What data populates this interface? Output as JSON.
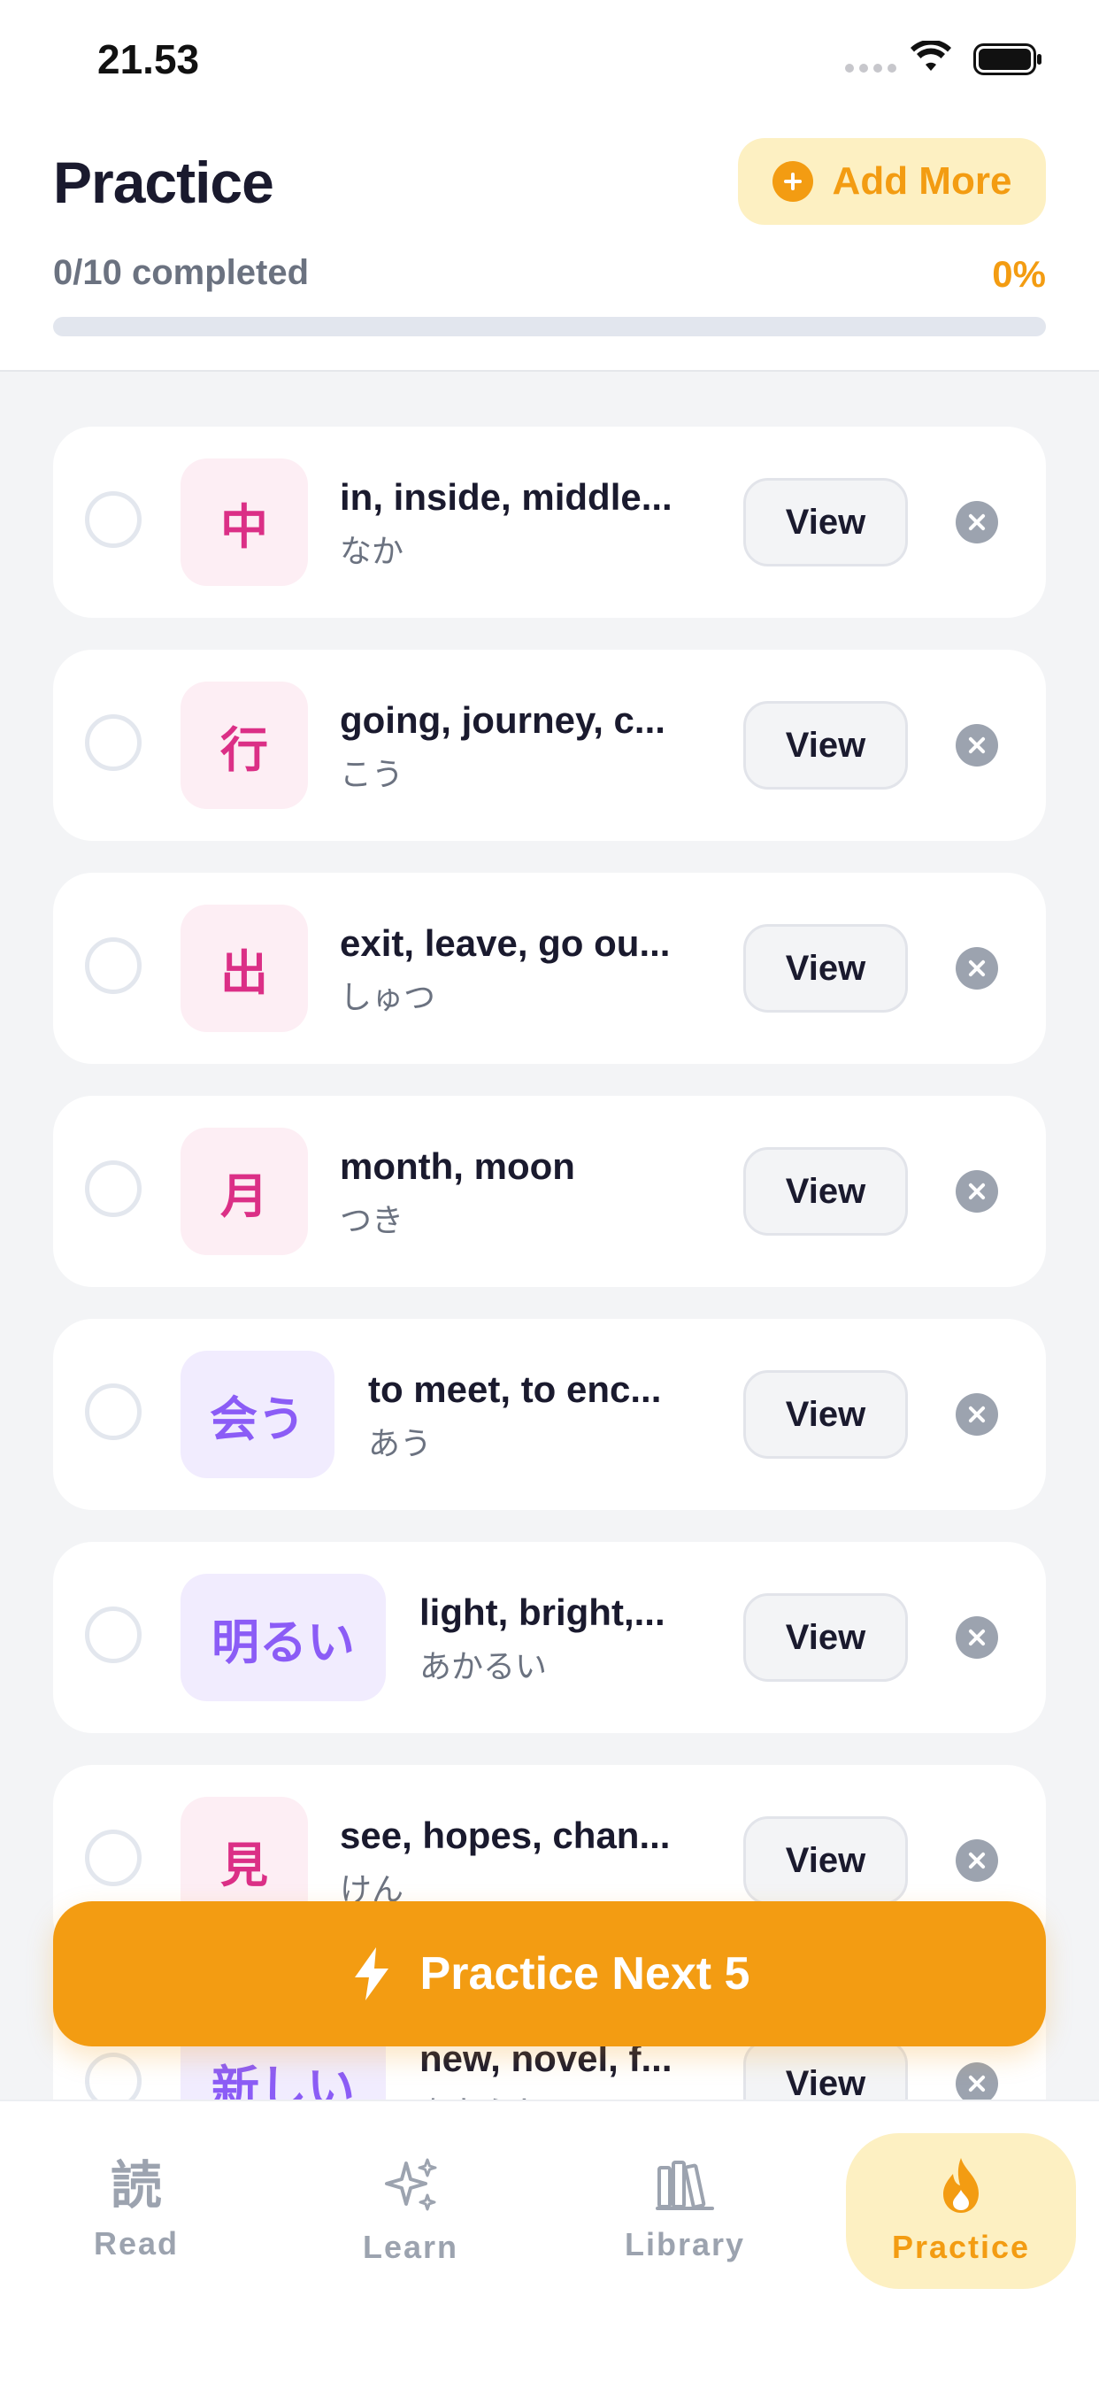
{
  "status_bar": {
    "time": "21.53"
  },
  "header": {
    "title": "Practice",
    "add_more_label": "Add More",
    "progress_text": "0/10 completed",
    "progress_percent": "0%",
    "progress_value": 0
  },
  "items": [
    {
      "kanji": "中",
      "meaning": "in, inside, middle...",
      "reading": "なか",
      "view_label": "View"
    },
    {
      "kanji": "行",
      "meaning": "going, journey, c...",
      "reading": "こう",
      "view_label": "View"
    },
    {
      "kanji": "出",
      "meaning": "exit, leave, go ou...",
      "reading": "しゅつ",
      "view_label": "View"
    },
    {
      "kanji": "月",
      "meaning": "month, moon",
      "reading": "つき",
      "view_label": "View"
    },
    {
      "kanji": "会う",
      "meaning": "to meet, to enc...",
      "reading": "あう",
      "view_label": "View"
    },
    {
      "kanji": "明るい",
      "meaning": "light, bright,...",
      "reading": "あかるい",
      "view_label": "View"
    },
    {
      "kanji": "見",
      "meaning": "see, hopes, chan...",
      "reading": "けん",
      "view_label": "View"
    },
    {
      "kanji": "新しい",
      "meaning": "new, novel, f...",
      "reading": "あたらしい",
      "view_label": "View"
    }
  ],
  "practice_next_label": "Practice Next 5",
  "nav": {
    "read": {
      "label": "Read",
      "glyph": "読"
    },
    "learn": {
      "label": "Learn"
    },
    "library": {
      "label": "Library"
    },
    "practice": {
      "label": "Practice"
    }
  },
  "colors": {
    "accent": "#f39c12",
    "accent_soft": "#fdf0c2",
    "kanji_pink": "#db2f86",
    "vocab_purple": "#8b5cf6"
  }
}
